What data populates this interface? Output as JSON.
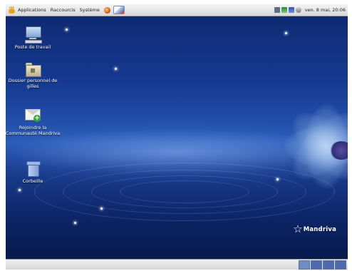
{
  "top_panel": {
    "menus": [
      "Applications",
      "Raccourcis",
      "Système"
    ],
    "launchers": [
      "web-browser-icon",
      "mail-client-icon"
    ],
    "tray_icons": [
      "printer-icon",
      "network-icon",
      "update-icon",
      "volume-icon"
    ],
    "clock": "ven. 8 mai, 20:06"
  },
  "desktop": {
    "icons": [
      {
        "label": "Poste de travail",
        "icon": "computer-icon"
      },
      {
        "label": "Dossier personnel de gilles",
        "icon": "home-folder-icon"
      },
      {
        "label": "Rejoindre la Communauté Mandriva",
        "icon": "join-community-icon"
      },
      {
        "label": "Corbeille",
        "icon": "trash-icon"
      }
    ],
    "brand": "Mandriva"
  },
  "bottom_panel": {
    "workspaces": [
      {
        "active": true
      },
      {
        "active": false
      },
      {
        "active": false
      },
      {
        "active": false
      }
    ]
  },
  "colors": {
    "desktop_top": "#0f2a73",
    "desktop_mid": "#2a5bb8",
    "panel": "#e6e6e6"
  }
}
